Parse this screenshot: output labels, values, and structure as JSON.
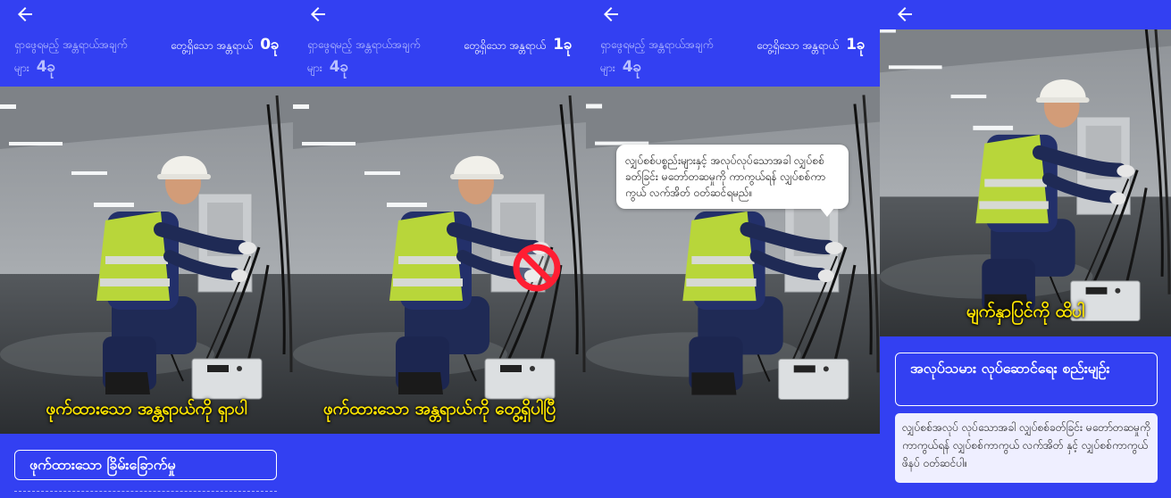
{
  "colors": {
    "background": "#3340f2",
    "caption": "#ffe600",
    "no_sign": "#ff1e33"
  },
  "icons": {
    "back": "arrow-left-icon",
    "no_sign": "prohibited-icon"
  },
  "panels": [
    {
      "to_find_label": "ရှာဖွေရမည့် အန္တရာယ်အချက် များ",
      "to_find_count": "4ခု",
      "found_label": "တွေ့ရှိသော အန္တရာယ်",
      "found_count": "0ခု",
      "caption": "ဖုက်ထားသော အန္တရာယ်ကို ရှာပါ",
      "hint_button": "ဖုက်ထားသော ခြိမ်းခြောက်မှု"
    },
    {
      "to_find_label": "ရှာဖွေရမည့် အန္တရာယ်အချက် များ",
      "to_find_count": "4ခု",
      "found_label": "တွေ့ရှိသော အန္တရာယ်",
      "found_count": "1ခု",
      "caption": "ဖုက်ထားသော အန္တရာယ်ကို တွေ့ရှိပါပြီ"
    },
    {
      "to_find_label": "ရှာဖွေရမည့် အန္တရာယ်အချက် များ",
      "to_find_count": "4ခု",
      "found_label": "တွေ့ရှိသော အန္တရာယ်",
      "found_count": "1ခု",
      "bubble": "လျှပ်စစ်ပစ္စည်းများနှင့် အလုပ်လုပ်သောအခါ လျှပ်စစ်ခတ်ခြင်း မတော်တဆမှုကို ကာကွယ်ရန် လျှပ်စစ်ကာကွယ် လက်အိတ် ဝတ်ဆင်ရမည်။"
    },
    {
      "caption": "မျက်နှာပြင်ကို ထိပါ",
      "procedure_button": "အလုပ်သမား လုပ်ဆောင်ရေး စည်းမျဉ်း",
      "procedure_text": "လျှပ်စစ်အလုပ် လုပ်သောအခါ လျှပ်စစ်ခတ်ခြင်း မတော်တဆမှုကို ကာကွယ်ရန် လျှပ်စစ်ကာကွယ် လက်အိတ် နှင့် လျှပ်စစ်ကာကွယ် ဖိနပ် ဝတ်ဆင်ပါ။"
    }
  ]
}
